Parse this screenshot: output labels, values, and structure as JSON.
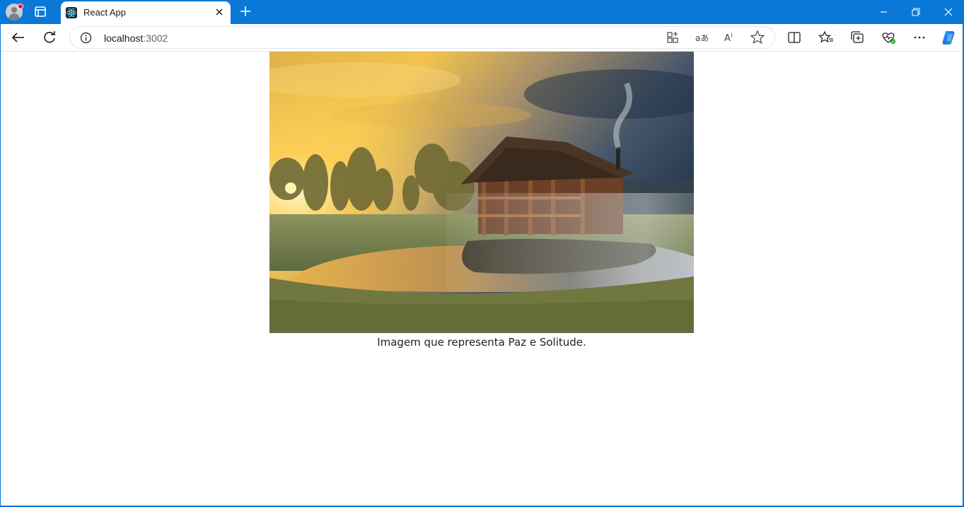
{
  "browser": {
    "tab": {
      "title": "React App"
    },
    "address": {
      "host": "localhost",
      "port": ":3002"
    }
  },
  "icons": {
    "profile": "profile-avatar-icon",
    "tab_actions": "tab-actions-icon",
    "favicon": "react-logo-icon",
    "close_tab": "close-icon",
    "new_tab": "plus-icon",
    "back": "arrow-left-icon",
    "refresh": "refresh-icon",
    "site_info": "info-icon",
    "app_available": "apps-icon",
    "translate": "translate-icon",
    "read_aloud": "read-aloud-icon",
    "favorite": "star-icon",
    "split_screen": "split-screen-icon",
    "favorites": "favorites-icon",
    "collections": "collections-icon",
    "browser_essentials": "heart-pulse-icon",
    "more": "more-icon",
    "copilot": "copilot-icon"
  },
  "page": {
    "caption": "Imagem que representa Paz e Solitude."
  }
}
